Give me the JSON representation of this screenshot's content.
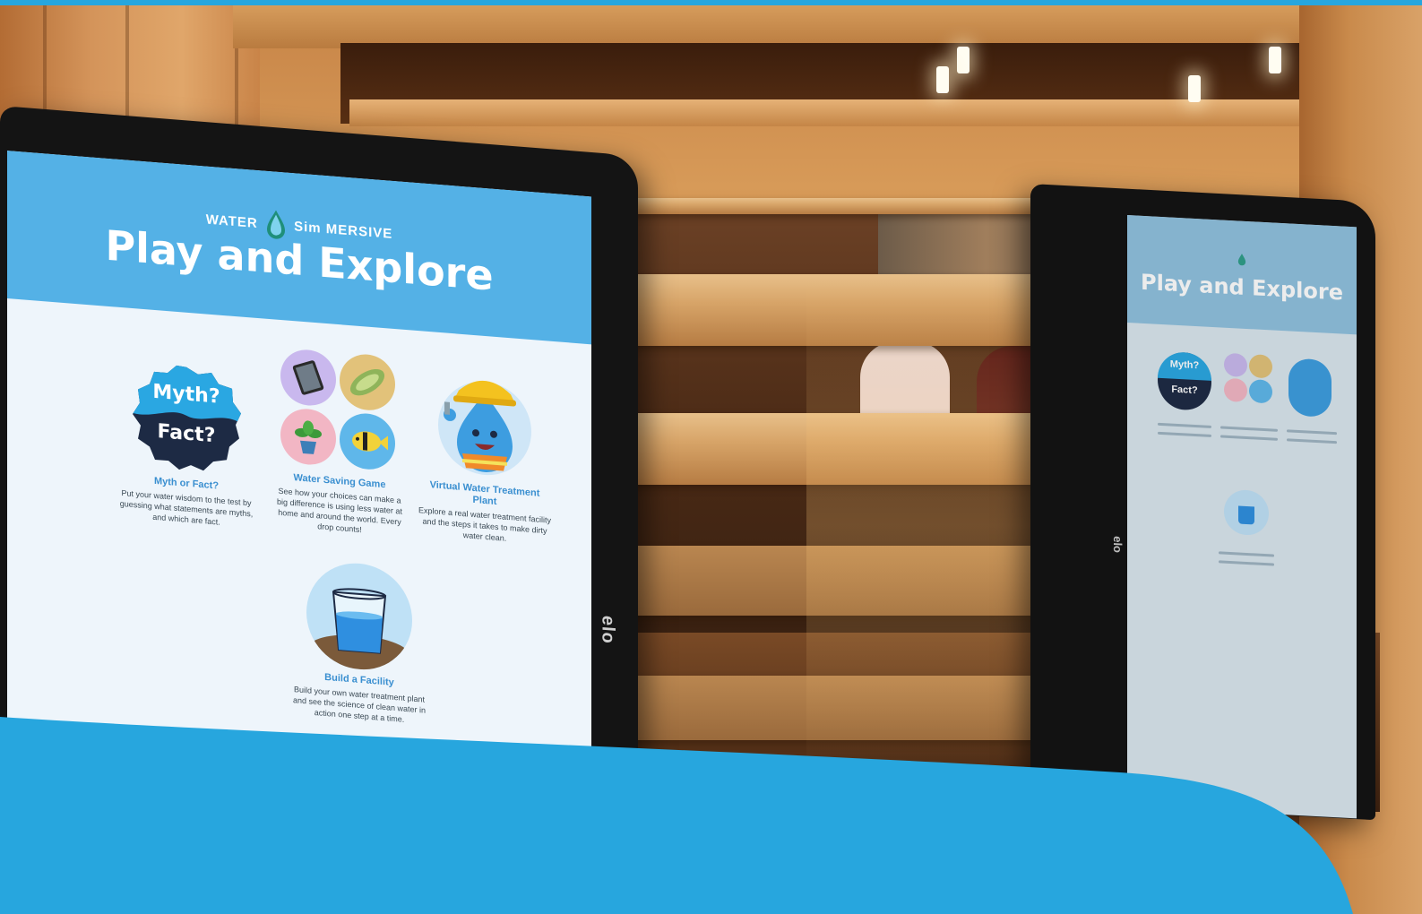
{
  "colors": {
    "brand_blue": "#27a6de",
    "screen_header": "#54b1e6",
    "card_title": "#3a8fd0",
    "myth_dark": "#1d2a44",
    "wood": "#d79a58"
  },
  "left_screen": {
    "brand": {
      "prefix": "WATER",
      "mark": "Sim",
      "suffix": "MERSIVE"
    },
    "title": "Play and Explore",
    "myth_badge": {
      "top": "Myth?",
      "bottom": "Fact?"
    },
    "cards": [
      {
        "title": "Myth or Fact?",
        "description": "Put your water wisdom to the test by guessing what statements are myths, and which are fact.",
        "icon": "myth-fact-badge-icon"
      },
      {
        "title": "Water Saving Game",
        "description": "See how your choices can make a big difference is using less water at home and around the world. Every drop counts!",
        "icon": "water-saving-icons"
      },
      {
        "title": "Virtual Water Treatment Plant",
        "description": "Explore a real water treatment facility and the steps it takes to make dirty water clean.",
        "icon": "water-drop-mascot-icon"
      },
      {
        "title": "Build a Facility",
        "description": "Build your own water treatment plant and see the science of clean water in action one step at a time.",
        "icon": "glass-of-water-icon"
      }
    ]
  },
  "right_screen": {
    "title": "Play and Explore",
    "myth_badge": {
      "top": "Myth?",
      "bottom": "Fact?"
    }
  },
  "hardware": {
    "left_logo": "elo",
    "right_logo": "elo"
  },
  "icons": [
    "tablet-icon",
    "zucchini-icon",
    "potted-plant-icon",
    "fish-icon",
    "hard-hat-mascot-icon",
    "glass-of-water-icon"
  ]
}
